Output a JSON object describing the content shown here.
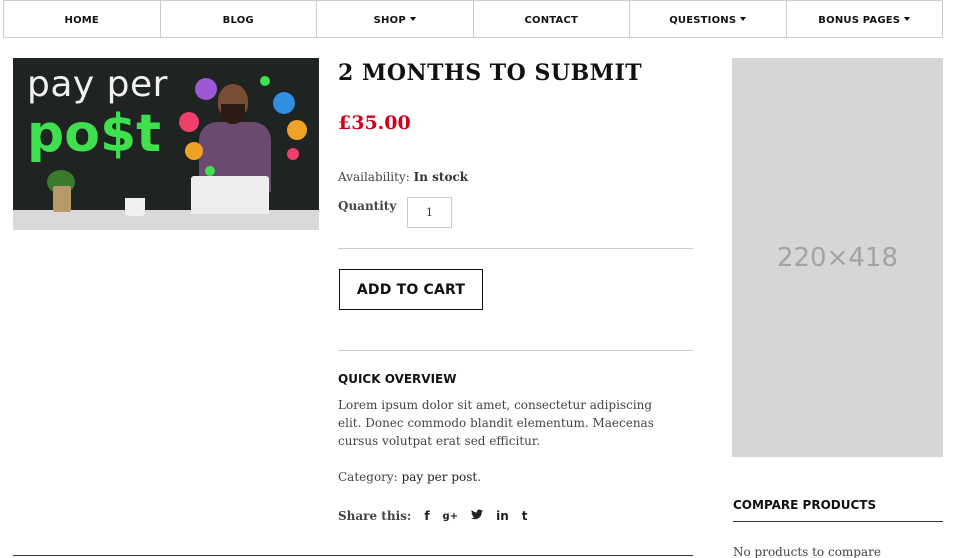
{
  "nav": {
    "items": [
      {
        "label": "HOME",
        "dropdown": false
      },
      {
        "label": "BLOG",
        "dropdown": false
      },
      {
        "label": "SHOP",
        "dropdown": true
      },
      {
        "label": "CONTACT",
        "dropdown": false
      },
      {
        "label": "QUESTIONS",
        "dropdown": true
      },
      {
        "label": "BONUS PAGES",
        "dropdown": true
      }
    ]
  },
  "product_image": {
    "line1": "pay per",
    "line2": "po$t",
    "colors": {
      "background": "#1f2322",
      "accent": "#3ee04d"
    }
  },
  "product": {
    "title": "2 MONTHS TO SUBMIT",
    "price": "£35.00",
    "availability_label": "Availability:",
    "availability_value": "In stock",
    "quantity_label": "Quantity",
    "quantity_value": "1",
    "add_to_cart_label": "ADD TO CART",
    "quick_overview_heading": "QUICK OVERVIEW",
    "quick_overview_text": "Lorem ipsum dolor sit amet, consectetur adipiscing elit. Donec commodo blandit elementum. Maecenas cursus volutpat erat sed efficitur.",
    "category_label": "Category:",
    "category_value": "pay per post",
    "share_label": "Share this:",
    "share_icons": [
      {
        "name": "facebook-icon",
        "glyph": "f"
      },
      {
        "name": "google-plus-icon",
        "glyph": "g+"
      },
      {
        "name": "twitter-icon",
        "glyph": "🐦"
      },
      {
        "name": "linkedin-icon",
        "glyph": "in"
      },
      {
        "name": "tumblr-icon",
        "glyph": "t"
      }
    ],
    "price_color": "#d0021b"
  },
  "sidebar": {
    "ad_placeholder": "220×418",
    "compare_heading": "COMPARE PRODUCTS",
    "compare_empty": "No products to compare"
  }
}
